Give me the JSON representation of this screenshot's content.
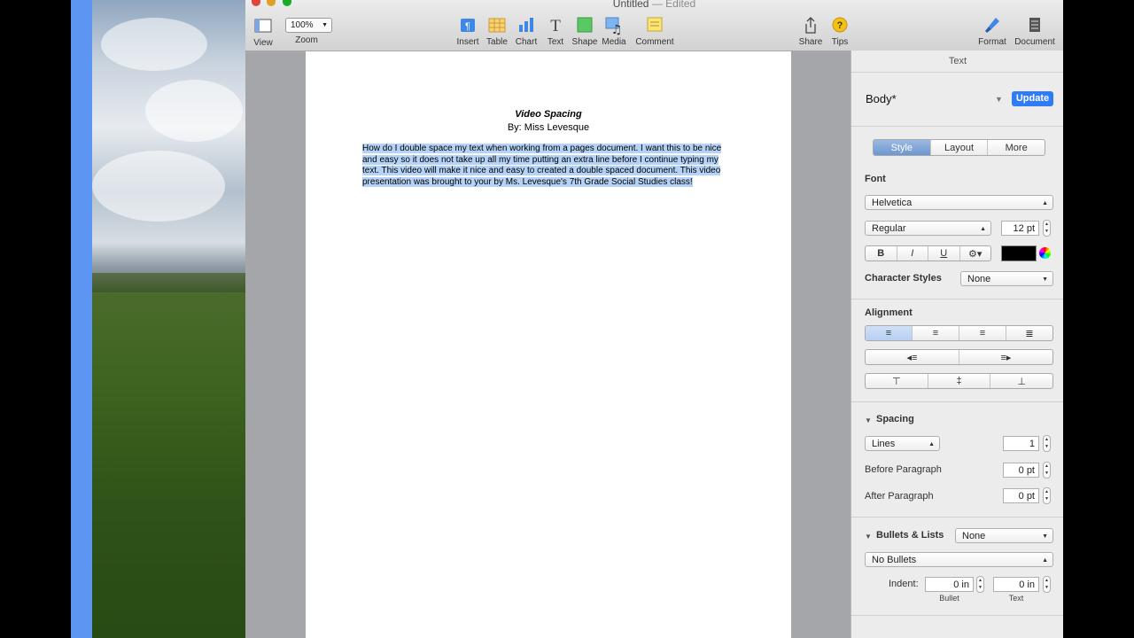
{
  "window": {
    "title": "Untitled",
    "status": "— Edited"
  },
  "toolbar": {
    "view": "View",
    "zoom_value": "100%",
    "zoom": "Zoom",
    "insert": "Insert",
    "table": "Table",
    "chart": "Chart",
    "text": "Text",
    "shape": "Shape",
    "media": "Media",
    "comment": "Comment",
    "share": "Share",
    "tips": "Tips",
    "format": "Format",
    "document": "Document"
  },
  "document": {
    "title": "Video Spacing",
    "byline": "By: Miss Levesque",
    "body": "How do I double space my text when working from a pages document. I want this to be nice and easy so it does not take up all my time putting an extra line before I continue typing my text. This video will make it nice and easy to created a double spaced document. This video presentation was brought to your by Ms. Levesque's 7th Grade Social Studies class!"
  },
  "inspector": {
    "header": "Text",
    "paragraph_style": "Body*",
    "update_label": "Update",
    "tabs": [
      "Style",
      "Layout",
      "More"
    ],
    "font_label": "Font",
    "font_family": "Helvetica",
    "font_typeface": "Regular",
    "font_size": "12 pt",
    "bold": "B",
    "italic": "I",
    "underline": "U",
    "character_styles_label": "Character Styles",
    "character_styles_value": "None",
    "alignment_label": "Alignment",
    "spacing_label": "Spacing",
    "spacing_mode": "Lines",
    "spacing_value": "1",
    "before_paragraph_label": "Before Paragraph",
    "before_paragraph_value": "0 pt",
    "after_paragraph_label": "After Paragraph",
    "after_paragraph_value": "0 pt",
    "bullets_label": "Bullets & Lists",
    "bullets_value": "None",
    "bullets_type": "No Bullets",
    "indent_label": "Indent:",
    "bullet_indent": "0 in",
    "text_indent": "0 in",
    "bullet_caption": "Bullet",
    "text_caption": "Text"
  },
  "colors": {
    "accent": "#2f7cf6",
    "selection": "#b5d3f7"
  }
}
